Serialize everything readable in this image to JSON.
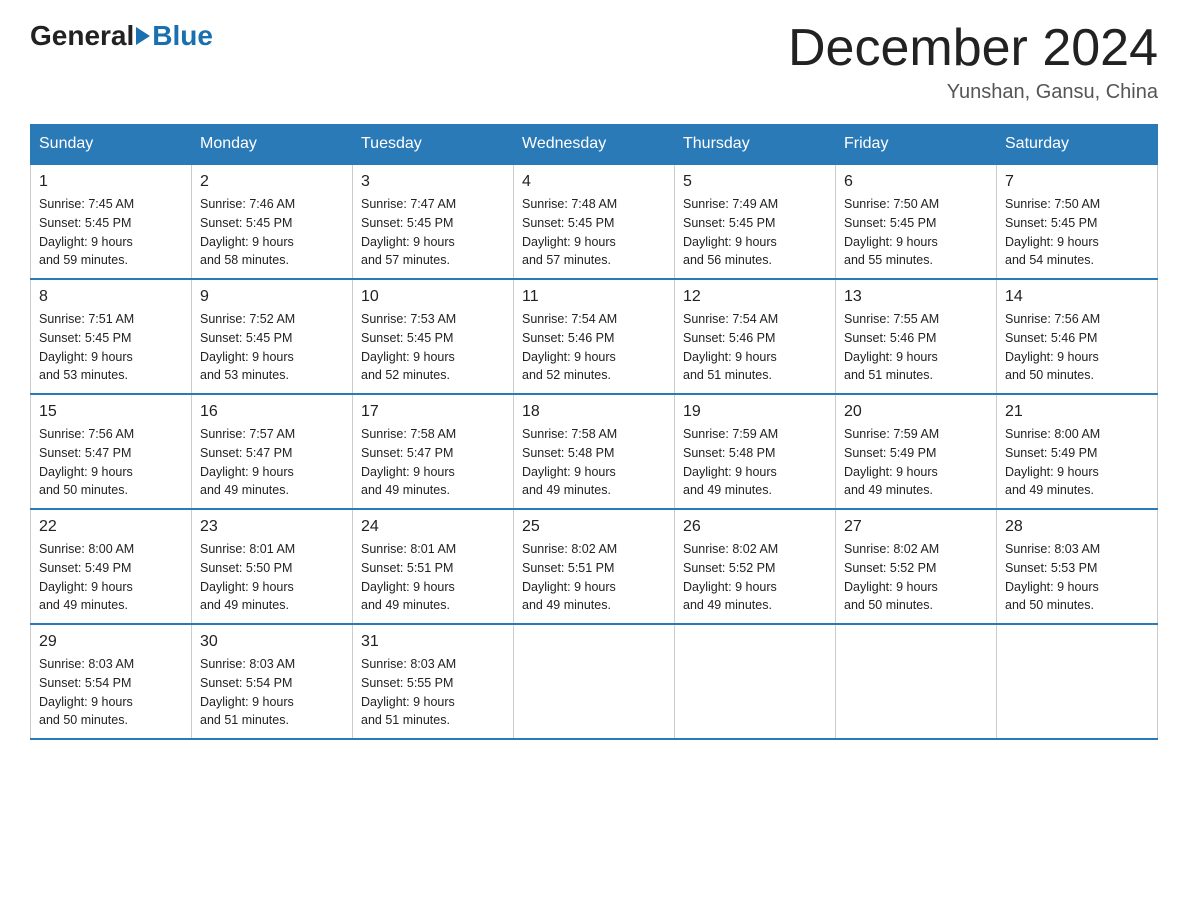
{
  "header": {
    "logo_general": "General",
    "logo_blue": "Blue",
    "month_title": "December 2024",
    "location": "Yunshan, Gansu, China"
  },
  "days_of_week": [
    "Sunday",
    "Monday",
    "Tuesday",
    "Wednesday",
    "Thursday",
    "Friday",
    "Saturday"
  ],
  "weeks": [
    [
      {
        "day": "1",
        "sunrise": "7:45 AM",
        "sunset": "5:45 PM",
        "daylight": "9 hours and 59 minutes."
      },
      {
        "day": "2",
        "sunrise": "7:46 AM",
        "sunset": "5:45 PM",
        "daylight": "9 hours and 58 minutes."
      },
      {
        "day": "3",
        "sunrise": "7:47 AM",
        "sunset": "5:45 PM",
        "daylight": "9 hours and 57 minutes."
      },
      {
        "day": "4",
        "sunrise": "7:48 AM",
        "sunset": "5:45 PM",
        "daylight": "9 hours and 57 minutes."
      },
      {
        "day": "5",
        "sunrise": "7:49 AM",
        "sunset": "5:45 PM",
        "daylight": "9 hours and 56 minutes."
      },
      {
        "day": "6",
        "sunrise": "7:50 AM",
        "sunset": "5:45 PM",
        "daylight": "9 hours and 55 minutes."
      },
      {
        "day": "7",
        "sunrise": "7:50 AM",
        "sunset": "5:45 PM",
        "daylight": "9 hours and 54 minutes."
      }
    ],
    [
      {
        "day": "8",
        "sunrise": "7:51 AM",
        "sunset": "5:45 PM",
        "daylight": "9 hours and 53 minutes."
      },
      {
        "day": "9",
        "sunrise": "7:52 AM",
        "sunset": "5:45 PM",
        "daylight": "9 hours and 53 minutes."
      },
      {
        "day": "10",
        "sunrise": "7:53 AM",
        "sunset": "5:45 PM",
        "daylight": "9 hours and 52 minutes."
      },
      {
        "day": "11",
        "sunrise": "7:54 AM",
        "sunset": "5:46 PM",
        "daylight": "9 hours and 52 minutes."
      },
      {
        "day": "12",
        "sunrise": "7:54 AM",
        "sunset": "5:46 PM",
        "daylight": "9 hours and 51 minutes."
      },
      {
        "day": "13",
        "sunrise": "7:55 AM",
        "sunset": "5:46 PM",
        "daylight": "9 hours and 51 minutes."
      },
      {
        "day": "14",
        "sunrise": "7:56 AM",
        "sunset": "5:46 PM",
        "daylight": "9 hours and 50 minutes."
      }
    ],
    [
      {
        "day": "15",
        "sunrise": "7:56 AM",
        "sunset": "5:47 PM",
        "daylight": "9 hours and 50 minutes."
      },
      {
        "day": "16",
        "sunrise": "7:57 AM",
        "sunset": "5:47 PM",
        "daylight": "9 hours and 49 minutes."
      },
      {
        "day": "17",
        "sunrise": "7:58 AM",
        "sunset": "5:47 PM",
        "daylight": "9 hours and 49 minutes."
      },
      {
        "day": "18",
        "sunrise": "7:58 AM",
        "sunset": "5:48 PM",
        "daylight": "9 hours and 49 minutes."
      },
      {
        "day": "19",
        "sunrise": "7:59 AM",
        "sunset": "5:48 PM",
        "daylight": "9 hours and 49 minutes."
      },
      {
        "day": "20",
        "sunrise": "7:59 AM",
        "sunset": "5:49 PM",
        "daylight": "9 hours and 49 minutes."
      },
      {
        "day": "21",
        "sunrise": "8:00 AM",
        "sunset": "5:49 PM",
        "daylight": "9 hours and 49 minutes."
      }
    ],
    [
      {
        "day": "22",
        "sunrise": "8:00 AM",
        "sunset": "5:49 PM",
        "daylight": "9 hours and 49 minutes."
      },
      {
        "day": "23",
        "sunrise": "8:01 AM",
        "sunset": "5:50 PM",
        "daylight": "9 hours and 49 minutes."
      },
      {
        "day": "24",
        "sunrise": "8:01 AM",
        "sunset": "5:51 PM",
        "daylight": "9 hours and 49 minutes."
      },
      {
        "day": "25",
        "sunrise": "8:02 AM",
        "sunset": "5:51 PM",
        "daylight": "9 hours and 49 minutes."
      },
      {
        "day": "26",
        "sunrise": "8:02 AM",
        "sunset": "5:52 PM",
        "daylight": "9 hours and 49 minutes."
      },
      {
        "day": "27",
        "sunrise": "8:02 AM",
        "sunset": "5:52 PM",
        "daylight": "9 hours and 50 minutes."
      },
      {
        "day": "28",
        "sunrise": "8:03 AM",
        "sunset": "5:53 PM",
        "daylight": "9 hours and 50 minutes."
      }
    ],
    [
      {
        "day": "29",
        "sunrise": "8:03 AM",
        "sunset": "5:54 PM",
        "daylight": "9 hours and 50 minutes."
      },
      {
        "day": "30",
        "sunrise": "8:03 AM",
        "sunset": "5:54 PM",
        "daylight": "9 hours and 51 minutes."
      },
      {
        "day": "31",
        "sunrise": "8:03 AM",
        "sunset": "5:55 PM",
        "daylight": "9 hours and 51 minutes."
      },
      {
        "day": "",
        "sunrise": "",
        "sunset": "",
        "daylight": ""
      },
      {
        "day": "",
        "sunrise": "",
        "sunset": "",
        "daylight": ""
      },
      {
        "day": "",
        "sunrise": "",
        "sunset": "",
        "daylight": ""
      },
      {
        "day": "",
        "sunrise": "",
        "sunset": "",
        "daylight": ""
      }
    ]
  ],
  "labels": {
    "sunrise_prefix": "Sunrise: ",
    "sunset_prefix": "Sunset: ",
    "daylight_prefix": "Daylight: "
  }
}
